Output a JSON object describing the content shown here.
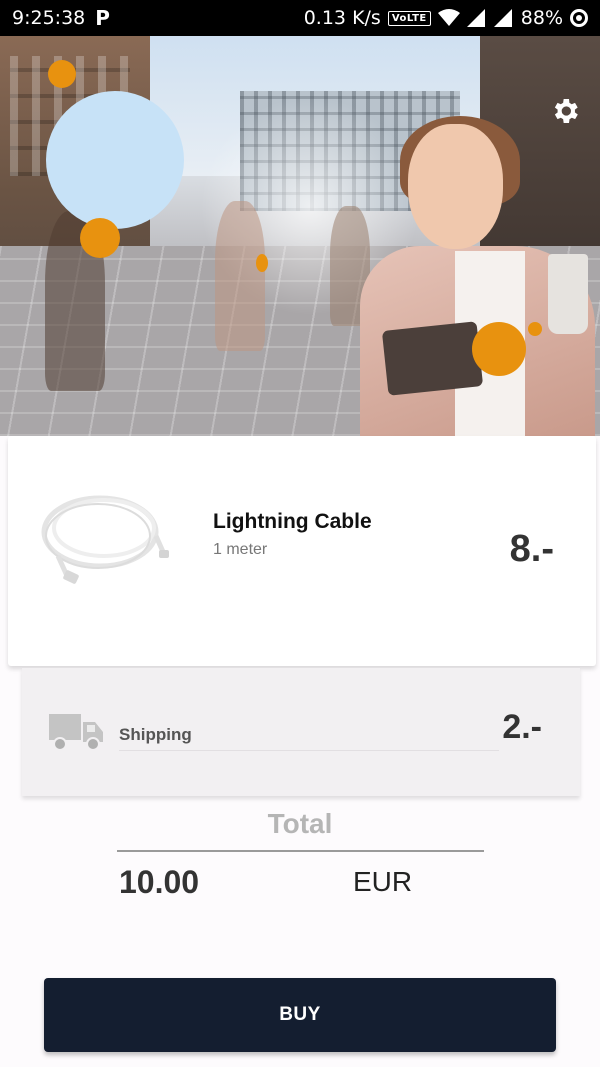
{
  "status_bar": {
    "time": "9:25:38",
    "p_label": "P",
    "speed": "0.13 K/s",
    "volte": "VoLTE",
    "battery": "88%"
  },
  "hero": {
    "settings_icon": "gear-icon",
    "accent_color": "#e8920f",
    "circle_color": "#c7e2f7"
  },
  "product": {
    "name": "Lightning Cable",
    "subtitle": "1 meter",
    "price": "8.-",
    "image_icon": "cable-image"
  },
  "shipping": {
    "label": "Shipping",
    "price": "2.-",
    "icon": "truck-icon"
  },
  "total": {
    "label": "Total",
    "amount": "10.00",
    "currency": "EUR"
  },
  "buy_button": {
    "label": "BUY",
    "color": "#141e30"
  }
}
